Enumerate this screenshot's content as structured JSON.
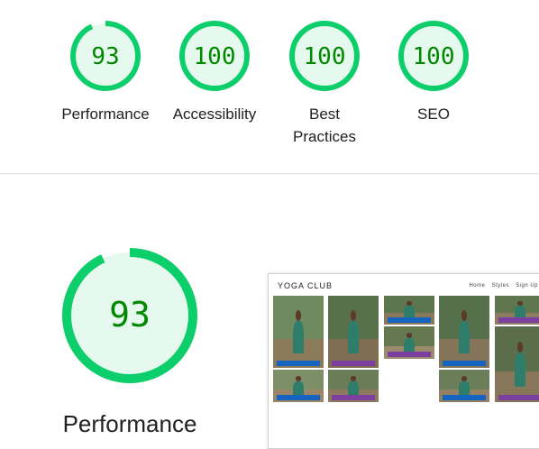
{
  "summary": {
    "categories": [
      {
        "label": "Performance",
        "score": 93
      },
      {
        "label": "Accessibility",
        "score": 100
      },
      {
        "label": "Best\nPractices",
        "score": 100
      },
      {
        "label": "SEO",
        "score": 100
      }
    ]
  },
  "performance_section": {
    "score": 93,
    "title": "Performance"
  },
  "screenshot_preview": {
    "brand": "YOGA CLUB",
    "nav": [
      "Home",
      "Styles",
      "Sign Up"
    ],
    "mat_colors": [
      "#1565c0",
      "#7b3fa0",
      "#7b3fa0",
      "#1565c0",
      "#7b3fa0",
      "#1565c0",
      "#7b3fa0",
      "#7b3fa0"
    ]
  },
  "colors": {
    "pass": "#0cce6b",
    "pass_text": "#008800",
    "pass_fill": "#e6f9ee"
  }
}
